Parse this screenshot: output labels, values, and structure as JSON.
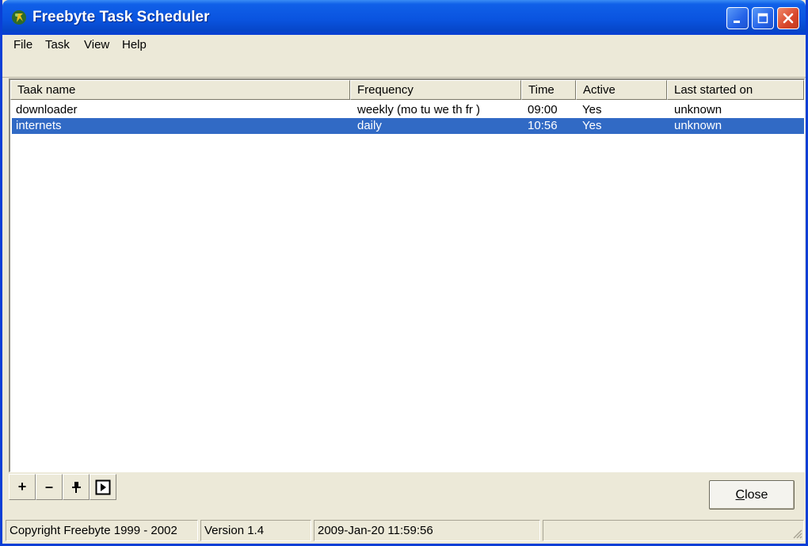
{
  "window": {
    "title": "Freebyte Task Scheduler"
  },
  "menu": {
    "items": [
      {
        "label": "File"
      },
      {
        "label": "Task"
      },
      {
        "label": "View"
      },
      {
        "label": "Help"
      }
    ]
  },
  "table": {
    "columns": [
      "Taak name",
      "Frequency",
      "Time",
      "Active",
      "Last started on"
    ],
    "rows": [
      {
        "name": "downloader",
        "frequency": "weekly (mo tu we th fr )",
        "time": "09:00",
        "active": "Yes",
        "last_started": "unknown",
        "selected": false
      },
      {
        "name": "internets",
        "frequency": "daily",
        "time": "10:56",
        "active": "Yes",
        "last_started": "unknown",
        "selected": true
      }
    ]
  },
  "toolbar": {
    "add_label": "+",
    "remove_label": "–",
    "edit_icon": "pin-icon",
    "run_icon": "run-icon"
  },
  "buttons": {
    "close_accel": "C",
    "close_rest": "lose"
  },
  "statusbar": {
    "copyright": "Copyright Freebyte 1999 - 2002",
    "version": "Version 1.4",
    "datetime": "2009-Jan-20 11:59:56",
    "empty": ""
  },
  "colors": {
    "title_bar": "#0a54e0",
    "selection": "#316ac5",
    "window_bg": "#ece9d8"
  }
}
